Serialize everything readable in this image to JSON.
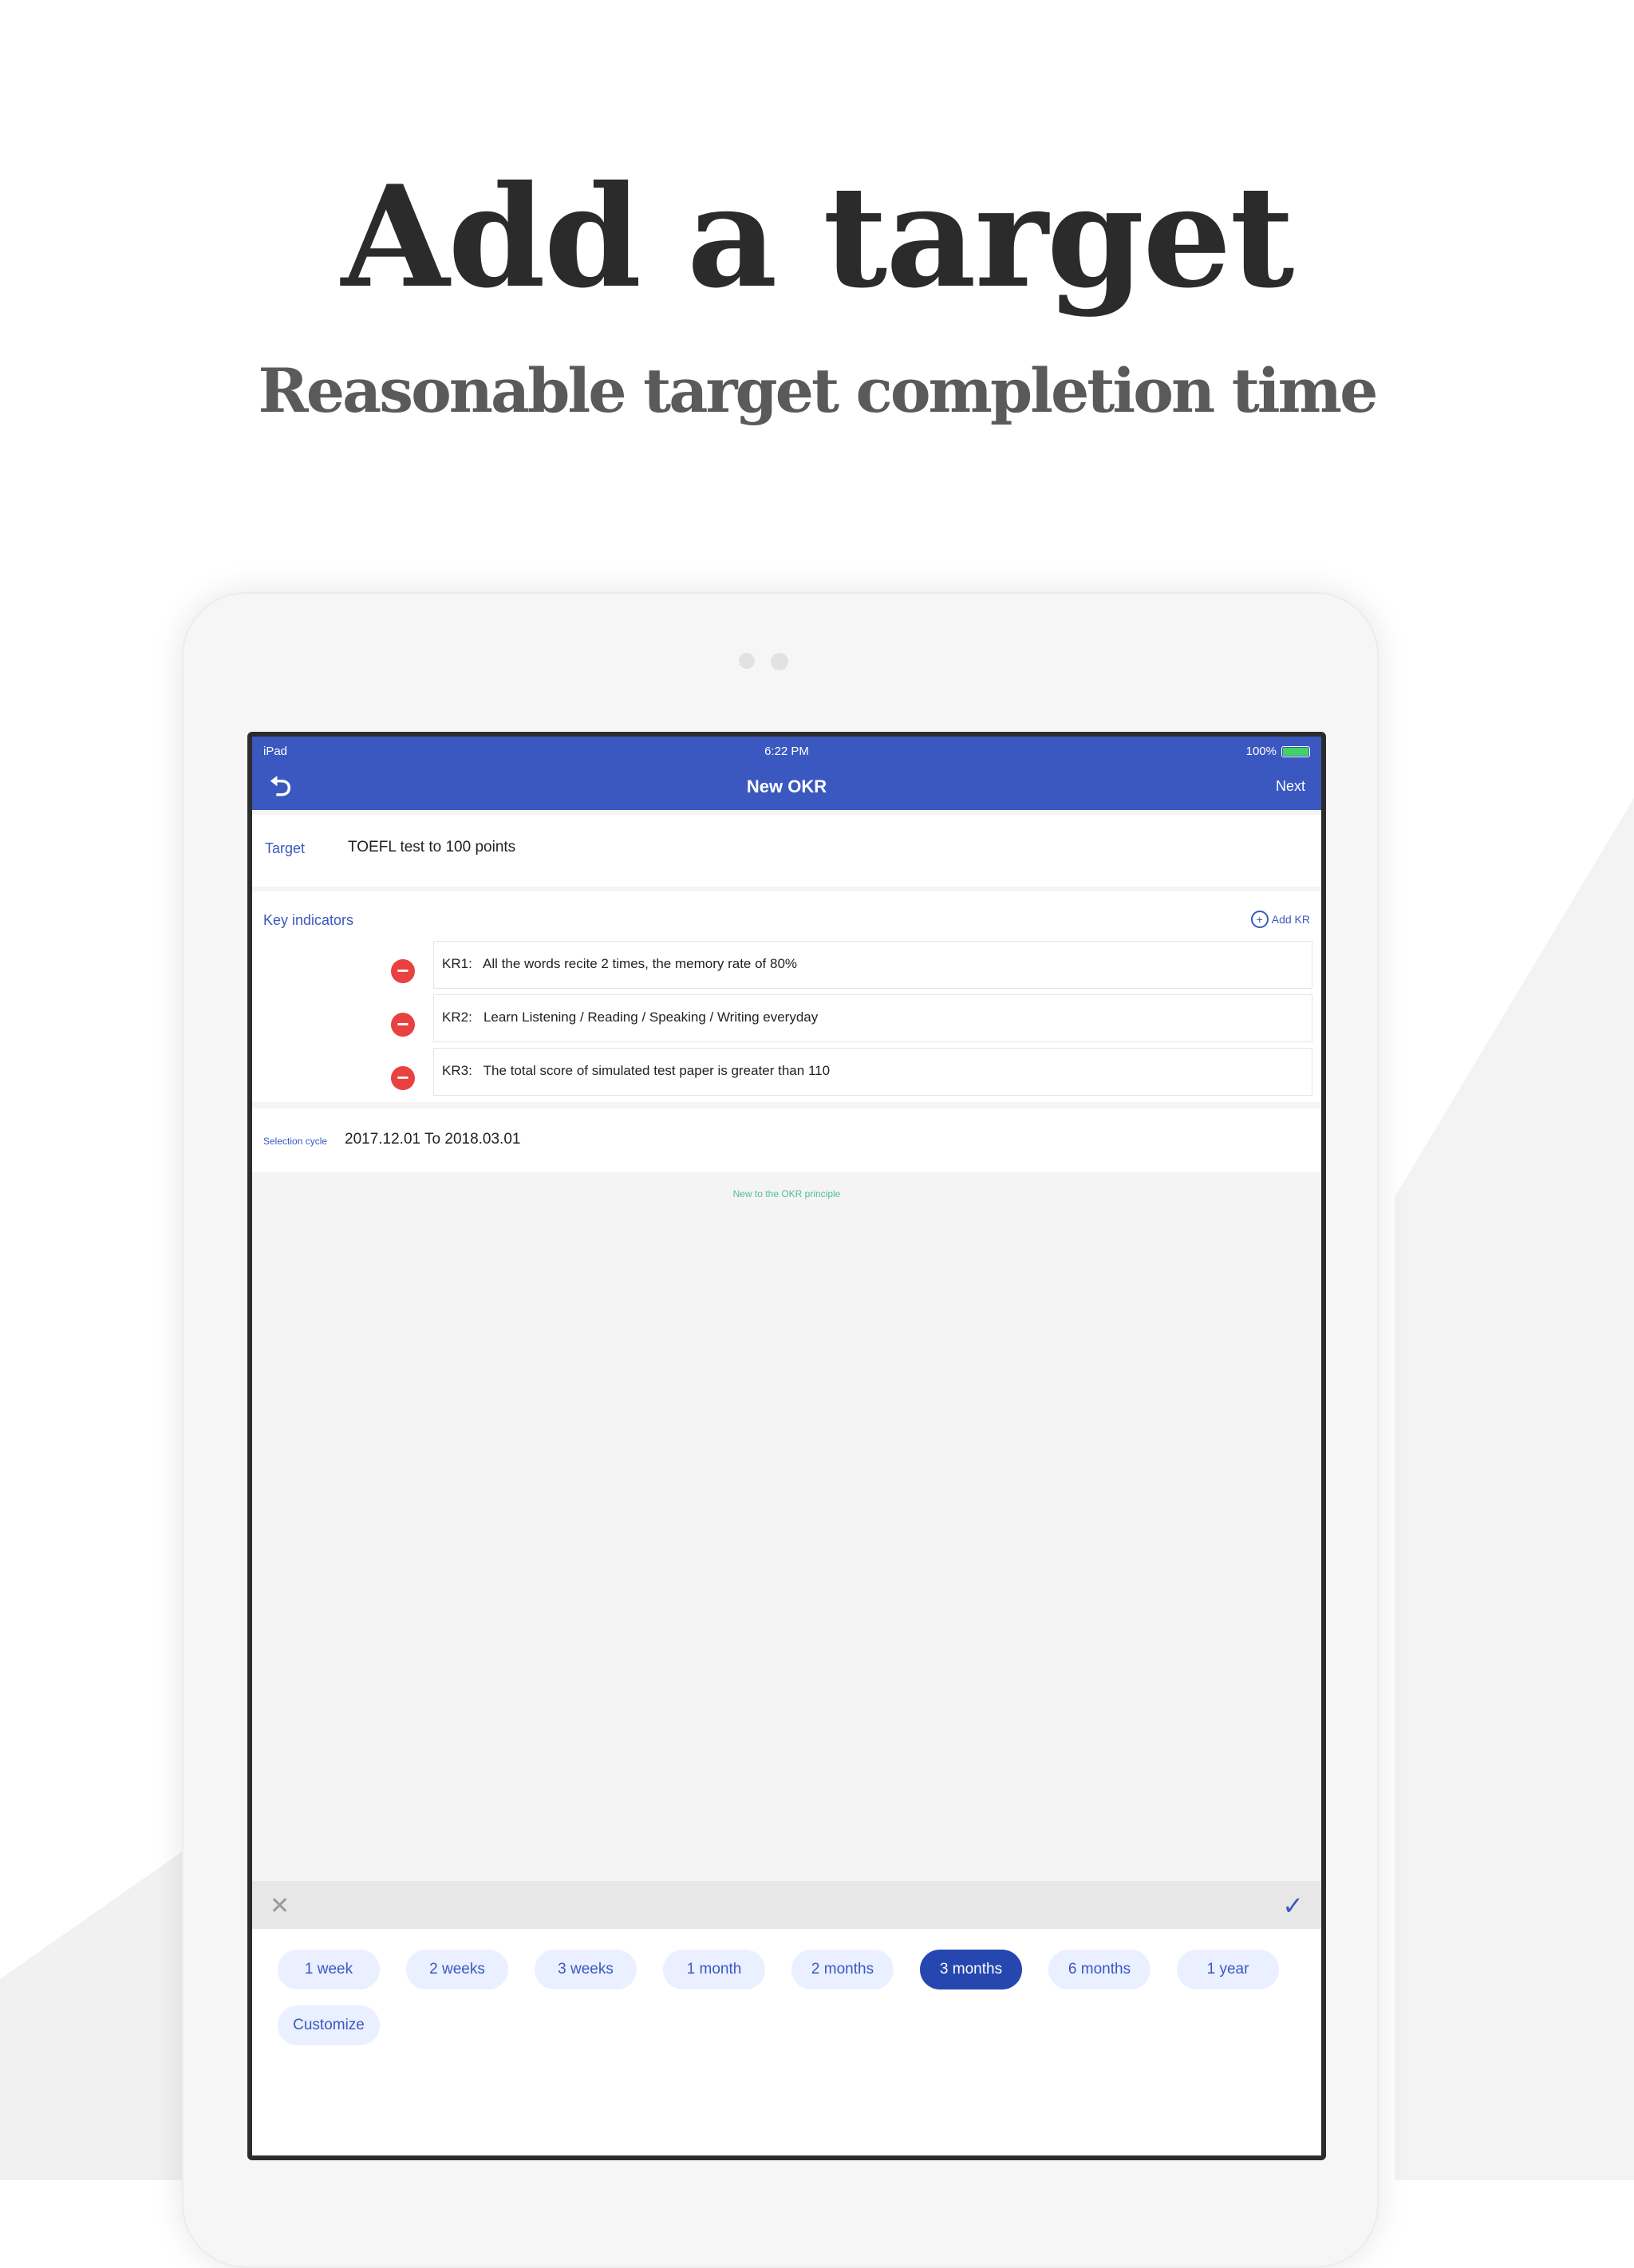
{
  "headline": "Add a target",
  "subheadline": "Reasonable target completion time",
  "status_bar": {
    "carrier": "iPad",
    "time": "6:22 PM",
    "battery": "100%"
  },
  "nav": {
    "title": "New OKR",
    "next_label": "Next"
  },
  "target": {
    "label": "Target",
    "value": "TOEFL test to 100 points"
  },
  "key_indicators": {
    "label": "Key indicators",
    "add_label": "Add KR",
    "items": [
      {
        "id": "KR1:",
        "text": "All the words recite 2 times, the memory rate of 80%"
      },
      {
        "id": "KR2:",
        "text": "Learn Listening / Reading / Speaking / Writing everyday"
      },
      {
        "id": "KR3:",
        "text": "The total score of simulated test paper is greater than 110"
      }
    ]
  },
  "selection_cycle": {
    "label": "Selection cycle",
    "value": "2017.12.01 To 2018.03.01"
  },
  "okr_link": "New to the OKR principle",
  "picker": {
    "options": [
      "1 week",
      "2 weeks",
      "3 weeks",
      "1 month",
      "2 months",
      "3 months",
      "6 months",
      "1 year",
      "Customize"
    ],
    "selected": "3 months"
  },
  "colors": {
    "accent": "#3a58c0",
    "selected_chip": "#2647b0",
    "remove": "#e94040"
  }
}
